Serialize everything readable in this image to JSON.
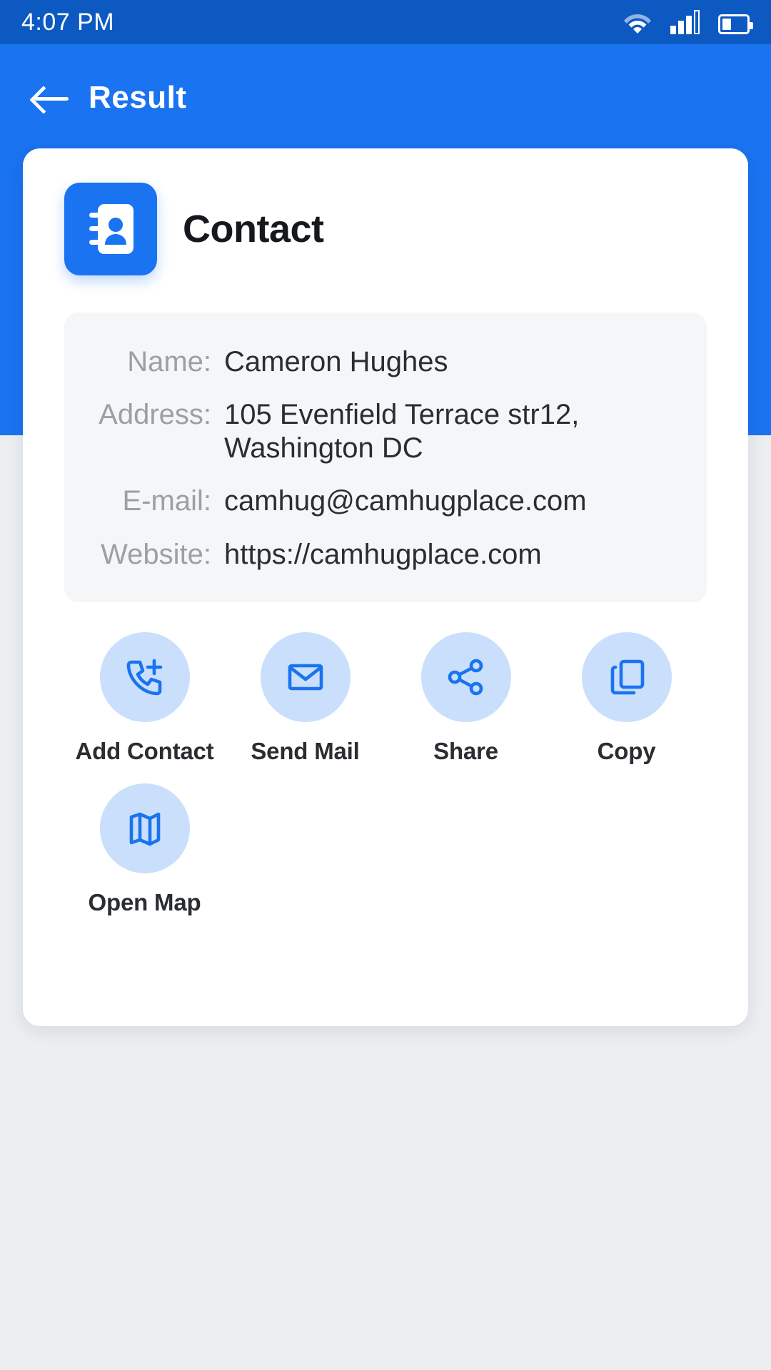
{
  "status_bar": {
    "time": "4:07 PM",
    "wifi_icon": "wifi-icon",
    "signal_icon": "cellular-signal-icon",
    "battery_icon": "battery-icon",
    "battery_level_percent": 36,
    "signal_bars_filled": 3,
    "signal_bars_total": 4,
    "background_color": "#0d59c2"
  },
  "header": {
    "back_icon": "back-arrow-icon",
    "title": "Result",
    "background_color": "#1a73f0"
  },
  "card": {
    "type_icon": "contact-book-icon",
    "type_title": "Contact",
    "accent_color": "#1a73f0",
    "details": [
      {
        "label": "Name:",
        "value": "Cameron Hughes"
      },
      {
        "label": "Address:",
        "value": "105 Evenfield Terrace str12, Washington DC"
      },
      {
        "label": "E-mail:",
        "value": "camhug@camhugplace.com"
      },
      {
        "label": "Website:",
        "value": "https://camhugplace.com"
      }
    ],
    "actions": [
      {
        "icon": "phone-add-icon",
        "label": "Add Contact"
      },
      {
        "icon": "envelope-icon",
        "label": "Send Mail"
      },
      {
        "icon": "share-icon",
        "label": "Share"
      },
      {
        "icon": "copy-icon",
        "label": "Copy"
      },
      {
        "icon": "map-icon",
        "label": "Open Map"
      }
    ],
    "action_circle_color": "#c9dffc",
    "action_icon_color": "#1a73f0"
  }
}
